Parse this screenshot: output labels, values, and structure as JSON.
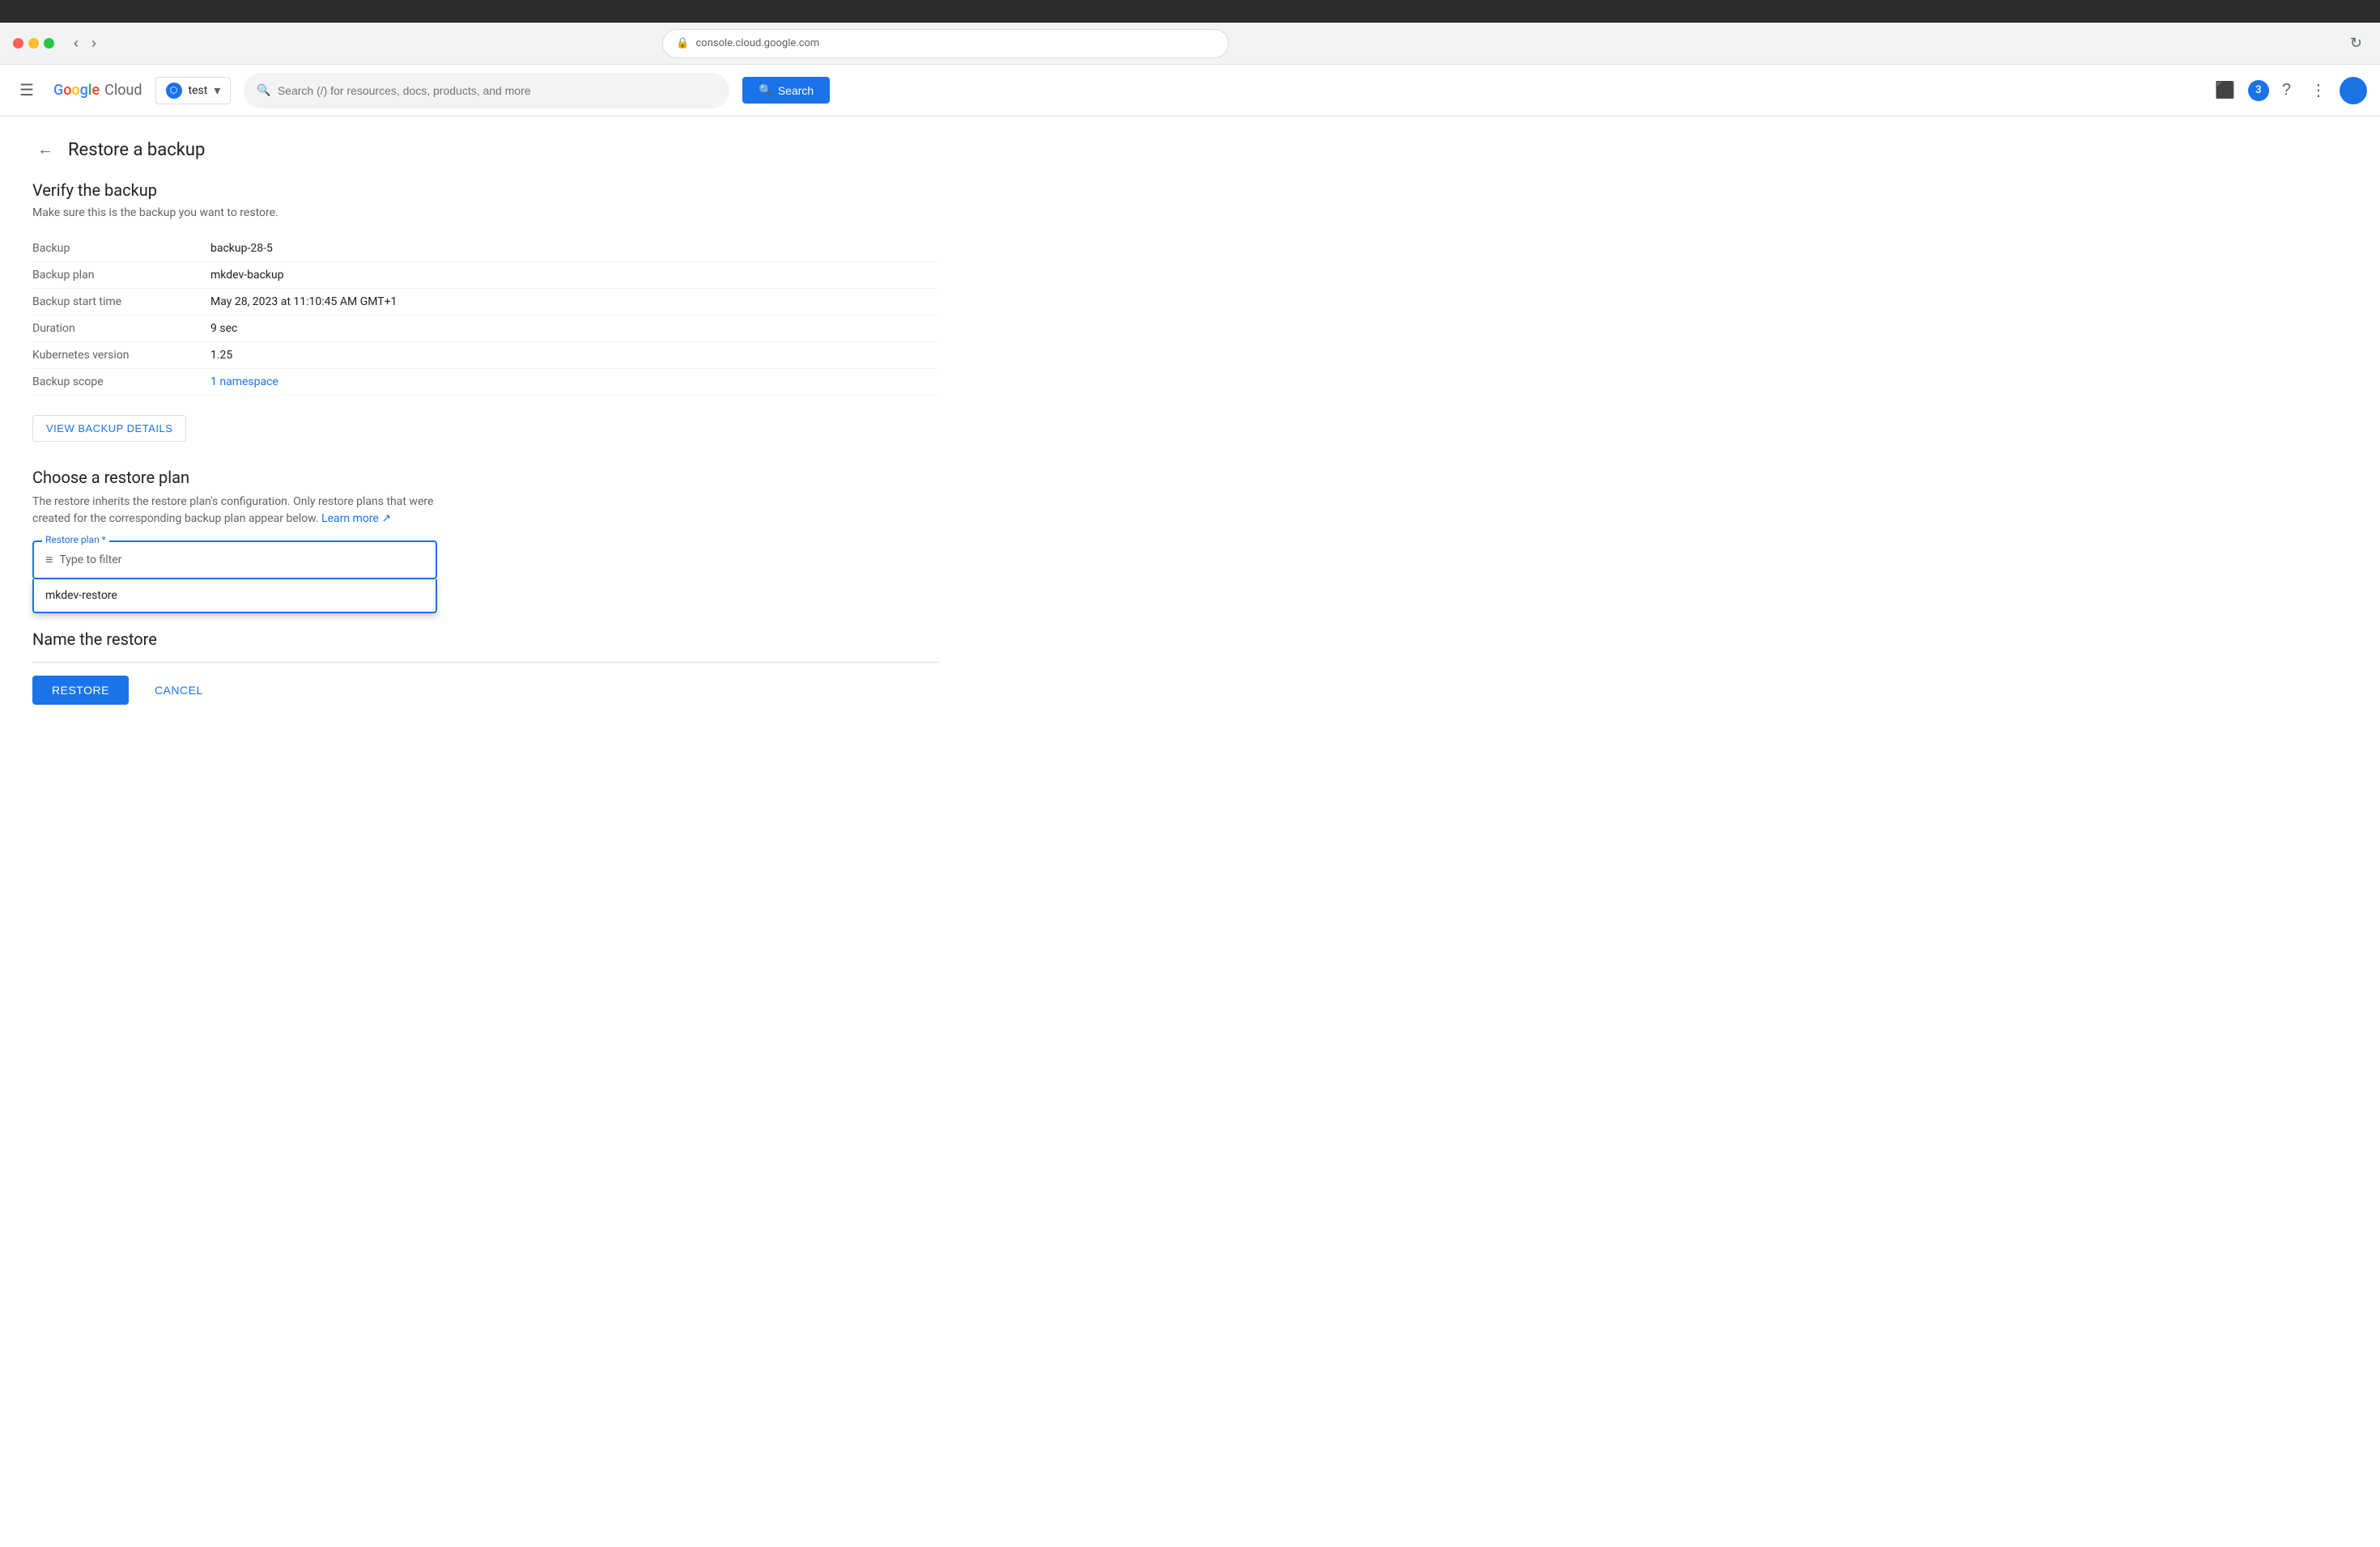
{
  "browser": {
    "bar_bg": "#2d2d2d",
    "address": "console.cloud.google.com",
    "back_label": "‹",
    "forward_label": "›"
  },
  "topbar": {
    "menu_icon": "☰",
    "logo_text": "Google Cloud",
    "project_label": "test",
    "search_placeholder": "Search (/) for resources, docs, products, and more",
    "search_button_label": "Search",
    "notification_count": "3"
  },
  "page": {
    "back_label": "←",
    "title": "Restore a backup"
  },
  "verify_section": {
    "title": "Verify the backup",
    "description": "Make sure this is the backup you want to restore.",
    "fields": [
      {
        "label": "Backup",
        "value": "backup-28-5",
        "is_link": false
      },
      {
        "label": "Backup plan",
        "value": "mkdev-backup",
        "is_link": false
      },
      {
        "label": "Backup start time",
        "value": "May 28, 2023 at 11:10:45 AM GMT+1",
        "is_link": false
      },
      {
        "label": "Duration",
        "value": "9 sec",
        "is_link": false
      },
      {
        "label": "Kubernetes version",
        "value": "1.25",
        "is_link": false
      },
      {
        "label": "Backup scope",
        "value": "1 namespace",
        "is_link": true
      }
    ],
    "view_backup_btn": "VIEW BACKUP DETAILS"
  },
  "restore_plan_section": {
    "title": "Choose a restore plan",
    "description": "The restore inherits the restore plan's configuration. Only restore plans that were created for the corresponding backup plan appear below.",
    "learn_more_label": "Learn more",
    "dropdown_label": "Restore plan *",
    "filter_icon": "≡",
    "filter_placeholder": "Type to filter",
    "options": [
      {
        "value": "mkdev-restore",
        "label": "mkdev-restore"
      }
    ]
  },
  "name_section": {
    "title": "Name the restore"
  },
  "actions": {
    "restore_label": "RESTORE",
    "cancel_label": "CANCEL"
  }
}
